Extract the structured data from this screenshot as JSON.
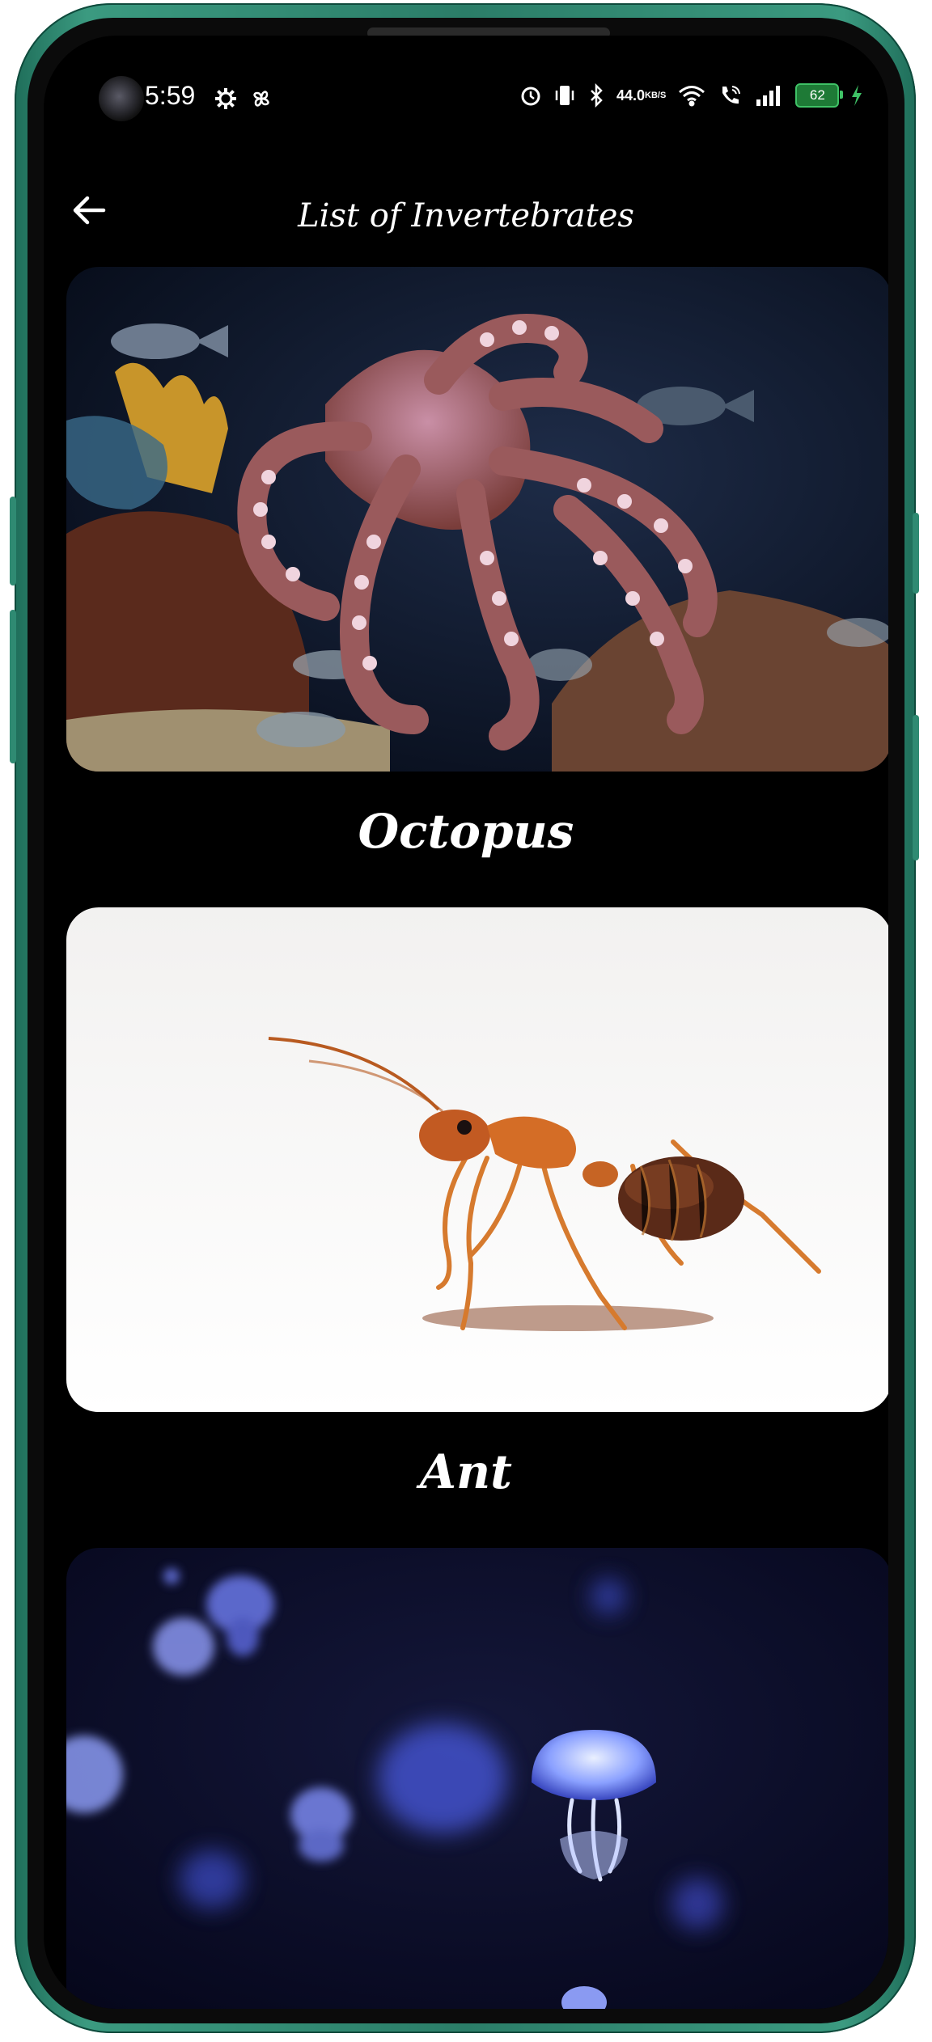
{
  "status_bar": {
    "time": "5:59",
    "network_speed": "44.0",
    "network_unit": "KB/S",
    "battery": "62",
    "icons_left": [
      "settings-icon",
      "pinwheel-icon"
    ],
    "icons_right": [
      "alarm-icon",
      "vibrate-icon",
      "bluetooth-icon",
      "wifi-icon",
      "volte-call-icon",
      "signal-icon",
      "battery-icon",
      "charging-icon"
    ]
  },
  "app_bar": {
    "title": "List of Invertebrates",
    "back_icon": "arrow-left-icon"
  },
  "items": [
    {
      "name": "Octopus"
    },
    {
      "name": "Ant"
    },
    {
      "name": ""
    }
  ],
  "colors": {
    "background": "#000000",
    "frame": "#2b7d68",
    "text": "#ffffff",
    "battery": "#3fc266"
  }
}
